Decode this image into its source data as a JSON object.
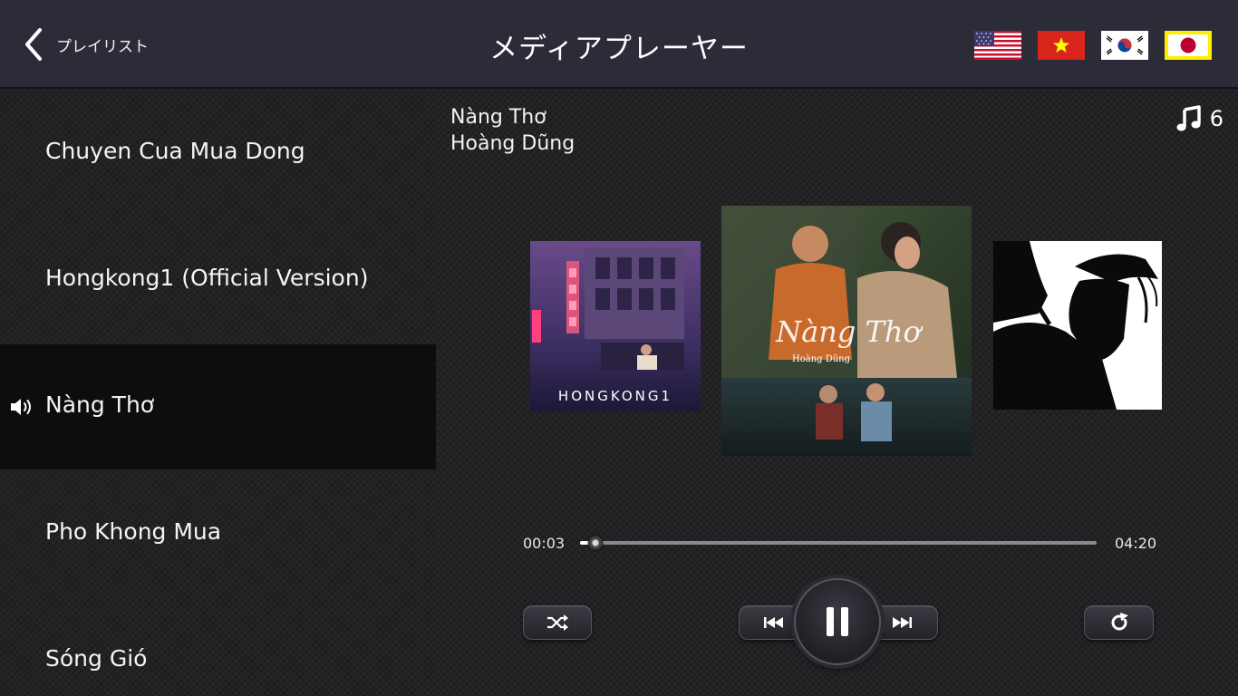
{
  "header": {
    "back_label": "プレイリスト",
    "title": "メディアプレーヤー",
    "languages": [
      "English (US flag)",
      "Vietnamese (VN flag)",
      "Korean (KR flag)",
      "Japanese (JP flag)"
    ],
    "selected_language": "Japanese (JP flag)"
  },
  "playlist": {
    "items": [
      {
        "label": "Chuyen Cua Mua Dong"
      },
      {
        "label": "Hongkong1 (Official Version)"
      },
      {
        "label": "Nàng Thơ"
      },
      {
        "label": "Pho Khong Mua"
      },
      {
        "label": "Sóng Gió"
      }
    ],
    "active_index": 2
  },
  "now_playing": {
    "title": "Nàng Thơ",
    "artist": "Hoàng Dũng",
    "track_count": "6",
    "current_time": "00:03",
    "total_time": "04:20",
    "progress": 0.03
  },
  "covers": {
    "left_text": "HONGKONG1",
    "center_script": "Nàng Thơ",
    "center_artist": "Hoàng Dũng"
  },
  "icons": {
    "back": "chevron-left-icon",
    "count": "music-note-icon",
    "speaker": "speaker-icon",
    "shuffle": "shuffle-icon",
    "prev": "previous-track-icon",
    "pause": "pause-icon",
    "next": "next-track-icon",
    "repeat": "repeat-icon"
  },
  "colors": {
    "header_bg": "#2c2c38",
    "active_row_bg": "#0d0d0f",
    "selected_flag_border": "#ffee00"
  }
}
